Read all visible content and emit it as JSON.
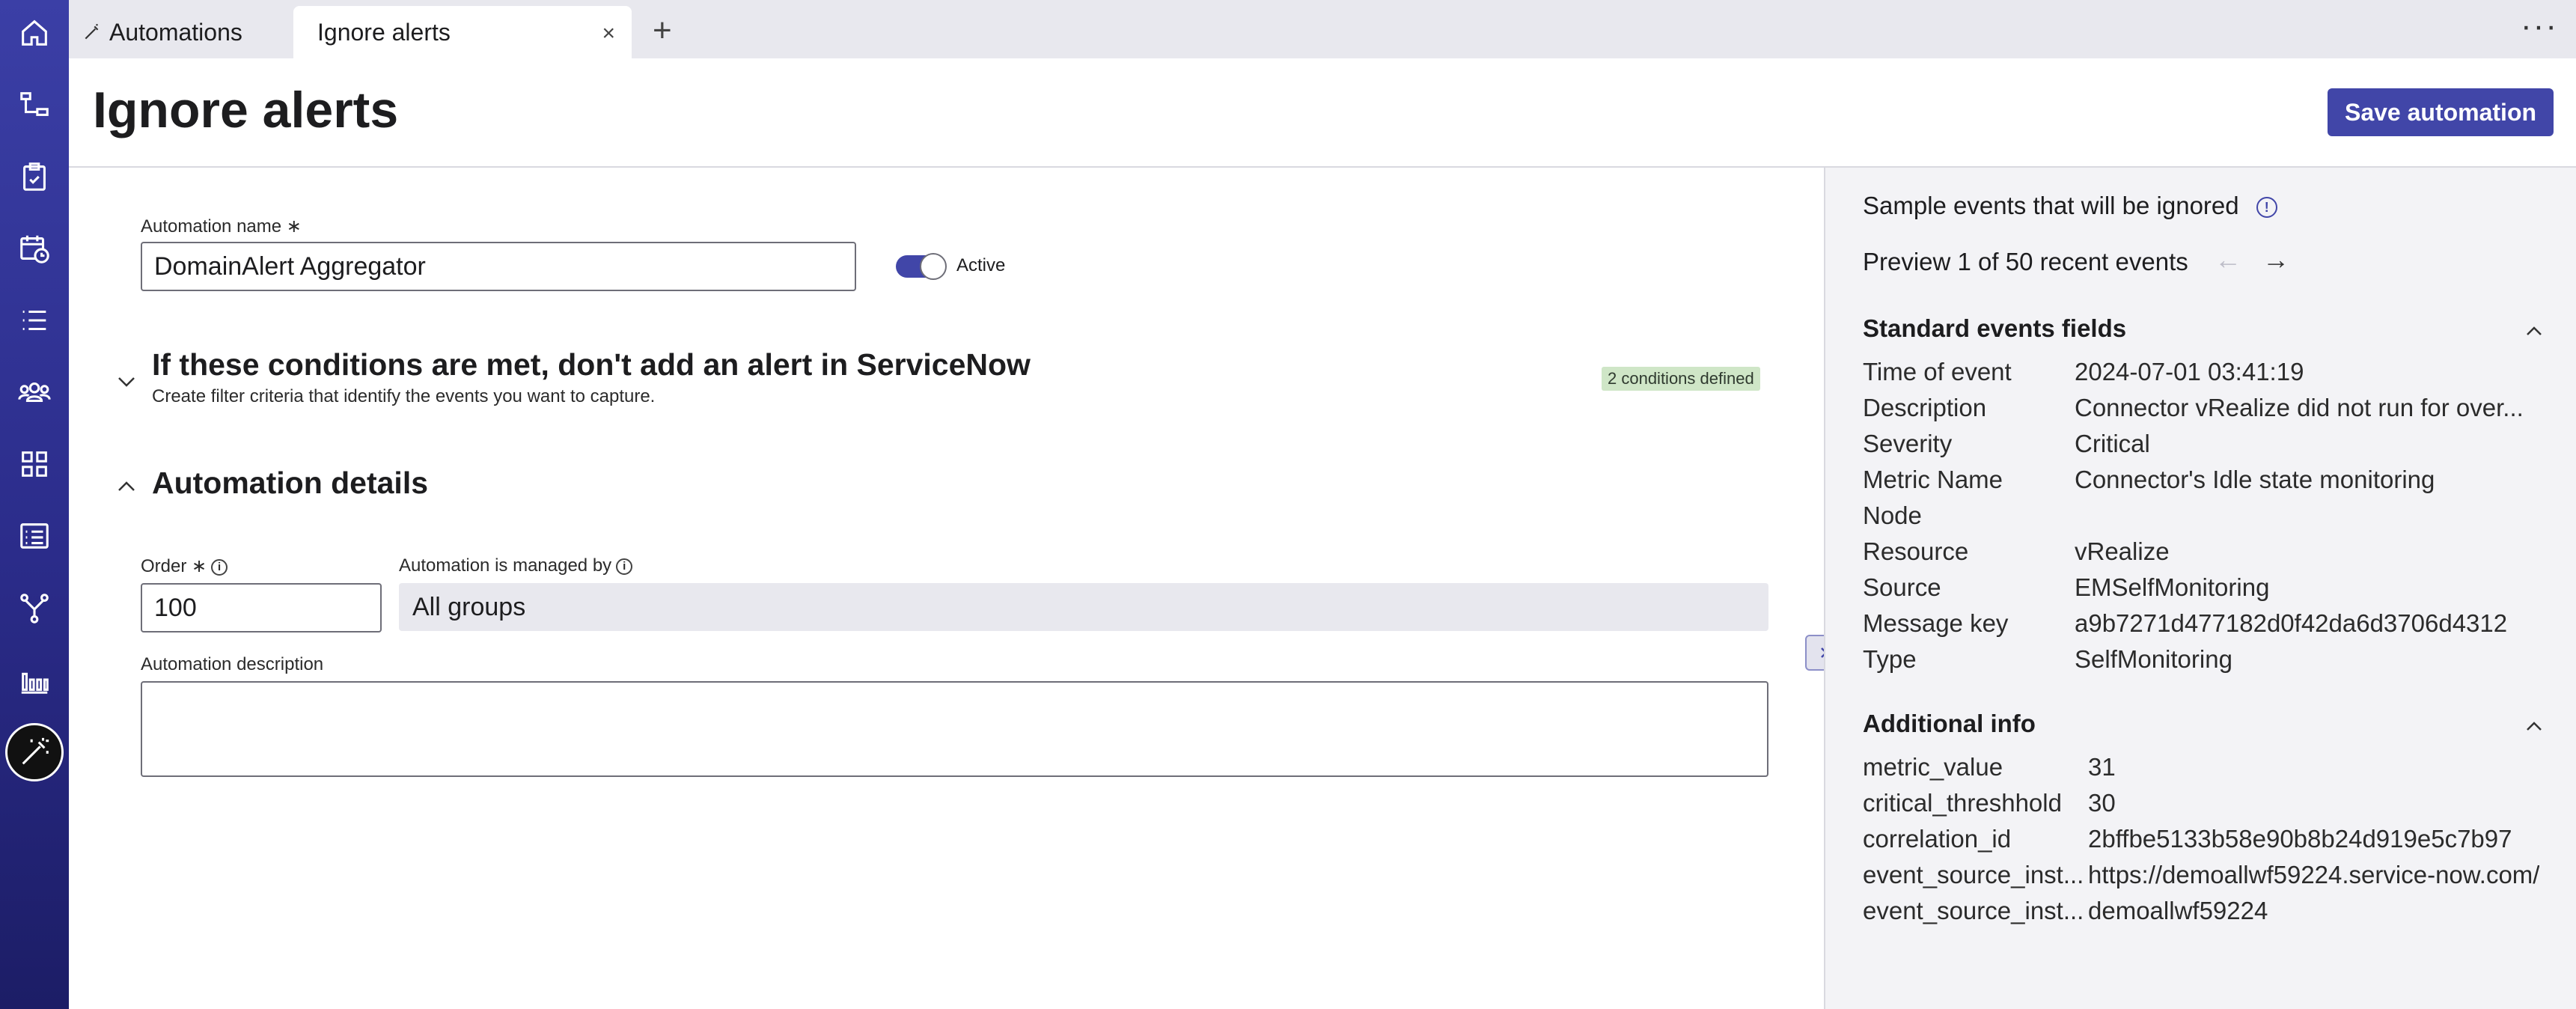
{
  "tabs": {
    "automations_label": "Automations",
    "ignore_label": "Ignore alerts",
    "close_glyph": "×",
    "add_glyph": "+",
    "more_glyph": "···"
  },
  "header": {
    "title": "Ignore alerts",
    "save_label": "Save automation"
  },
  "form": {
    "name_label": "Automation name",
    "required_mark": "∗",
    "name_value": "DomainAlert Aggregator",
    "active_label": "Active",
    "active_on": true,
    "conditions_title": "If these conditions are met, don't add an alert in ServiceNow",
    "conditions_subtitle": "Create filter criteria that identify the events you want to capture.",
    "conditions_badge": "2 conditions defined",
    "details_title": "Automation details",
    "order_label": "Order",
    "order_value": "100",
    "managed_label": "Automation is managed by",
    "managed_value": "All groups",
    "description_label": "Automation description",
    "description_value": ""
  },
  "panel": {
    "sample_title": "Sample events that will be ignored",
    "preview_text": "Preview 1 of 50 recent events",
    "standard_title": "Standard events fields",
    "standard_fields": [
      {
        "key": "Time of event",
        "value": "2024-07-01 03:41:19"
      },
      {
        "key": "Description",
        "value": "Connector vRealize did not run for over..."
      },
      {
        "key": "Severity",
        "value": "Critical"
      },
      {
        "key": "Metric Name",
        "value": "Connector's Idle state monitoring"
      },
      {
        "key": "Node",
        "value": ""
      },
      {
        "key": "Resource",
        "value": "vRealize"
      },
      {
        "key": "Source",
        "value": "EMSelfMonitoring"
      },
      {
        "key": "Message key",
        "value": "a9b7271d477182d0f42da6d3706d4312"
      },
      {
        "key": "Type",
        "value": "SelfMonitoring"
      }
    ],
    "additional_title": "Additional info",
    "additional_fields": [
      {
        "key": "metric_value",
        "value": "31"
      },
      {
        "key": "critical_threshhold",
        "value": "30"
      },
      {
        "key": "correlation_id",
        "value": "2bffbe5133b58e90b8b24d919e5c7b97"
      },
      {
        "key": "event_source_inst...",
        "value": "https://demoallwf59224.service-now.com/"
      },
      {
        "key": "event_source_inst...",
        "value": "demoallwf59224"
      }
    ]
  },
  "sidebar": {
    "icons": [
      "home-icon",
      "flow-icon",
      "clipboard-icon",
      "calendar-clock-icon",
      "list-icon",
      "users-icon",
      "grid-icon",
      "report-icon",
      "branch-icon",
      "bar-chart-icon",
      "magic-wand-icon"
    ]
  },
  "colors": {
    "accent": "#4146a8",
    "badge_bg": "#cfe6c7"
  }
}
